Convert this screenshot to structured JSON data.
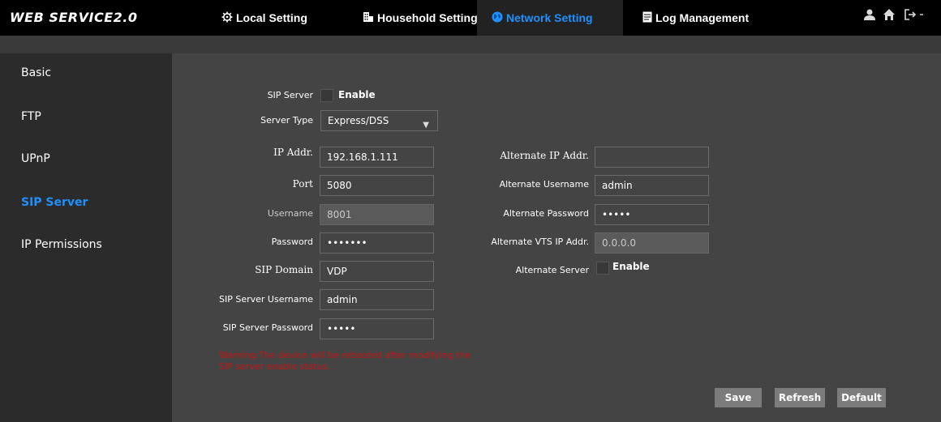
{
  "header": {
    "brand": "WEB SERVICE2.0",
    "nav": [
      {
        "label": "Local Setting",
        "icon": "gear-icon"
      },
      {
        "label": "Household Setting",
        "icon": "building-icon"
      },
      {
        "label": "Network Setting",
        "icon": "globe-icon"
      },
      {
        "label": "Log Management",
        "icon": "document-icon"
      }
    ],
    "active_nav": "Network Setting",
    "right_icons": [
      "user-icon",
      "home-icon",
      "logout-icon"
    ]
  },
  "sidebar": {
    "items": [
      {
        "label": "Basic"
      },
      {
        "label": "FTP"
      },
      {
        "label": "UPnP"
      },
      {
        "label": "SIP Server"
      },
      {
        "label": "IP Permissions"
      }
    ],
    "active": "SIP Server"
  },
  "form": {
    "sip_server": {
      "label": "SIP Server",
      "option": "Enable",
      "checked": false
    },
    "server_type": {
      "label": "Server Type",
      "value": "Express/DSS"
    },
    "ip_addr": {
      "label": "IP Addr.",
      "value": "192.168.1.111"
    },
    "port": {
      "label": "Port",
      "value": "5080"
    },
    "username": {
      "label": "Username",
      "value": "8001",
      "disabled": true
    },
    "password": {
      "label": "Password",
      "value": "•••••••"
    },
    "sip_domain": {
      "label": "SIP Domain",
      "value": "VDP"
    },
    "sip_server_username": {
      "label": "SIP Server Username",
      "value": "admin"
    },
    "sip_server_password": {
      "label": "SIP Server Password",
      "value": "•••••"
    },
    "alt_ip_addr": {
      "label": "Alternate IP Addr.",
      "value": ""
    },
    "alt_username": {
      "label": "Alternate Username",
      "value": "admin"
    },
    "alt_password": {
      "label": "Alternate Password",
      "value": "•••••"
    },
    "alt_vts_ip": {
      "label": "Alternate VTS IP Addr.",
      "value": "0.0.0.0",
      "disabled": true
    },
    "alt_server": {
      "label": "Alternate Server",
      "option": "Enable",
      "checked": false
    }
  },
  "warning": "Warning:The device will be rebooted after modifying the SIP server enable status.",
  "buttons": {
    "save": "Save",
    "refresh": "Refresh",
    "default": "Default"
  },
  "colors": {
    "accent": "#1e90ff",
    "warning": "#c41515",
    "button": "#7c7c7c"
  }
}
